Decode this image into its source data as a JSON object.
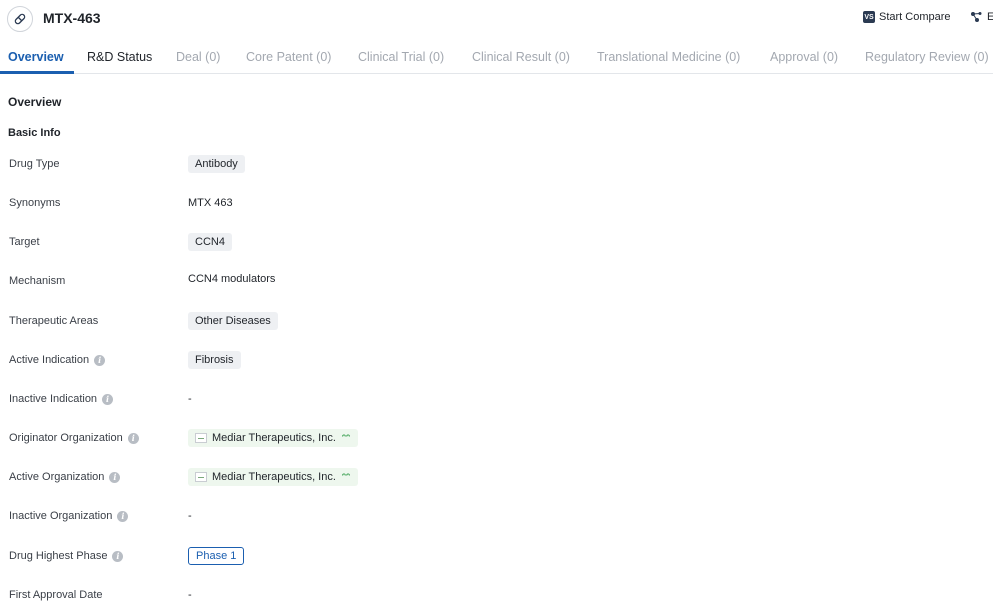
{
  "header": {
    "title": "MTX-463",
    "compare_label": "Start Compare",
    "compare_badge": "VS",
    "more_label": "E"
  },
  "tabs": [
    {
      "label": "Overview"
    },
    {
      "label": "R&D Status"
    },
    {
      "label": "Deal (0)"
    },
    {
      "label": "Core Patent (0)"
    },
    {
      "label": "Clinical Trial (0)"
    },
    {
      "label": "Clinical Result (0)"
    },
    {
      "label": "Translational Medicine (0)"
    },
    {
      "label": "Approval (0)"
    },
    {
      "label": "Regulatory Review (0)"
    }
  ],
  "overview": {
    "title": "Overview",
    "basic_info_title": "Basic Info",
    "fields": {
      "drug_type": {
        "label": "Drug Type",
        "value": "Antibody"
      },
      "synonyms": {
        "label": "Synonyms",
        "value": "MTX 463"
      },
      "target": {
        "label": "Target",
        "value": "CCN4"
      },
      "mechanism": {
        "label": "Mechanism",
        "value": "CCN4 modulators"
      },
      "therapeutic_areas": {
        "label": "Therapeutic Areas",
        "value": "Other Diseases"
      },
      "active_indication": {
        "label": "Active Indication",
        "value": "Fibrosis"
      },
      "inactive_indication": {
        "label": "Inactive Indication",
        "value": "-"
      },
      "originator_org": {
        "label": "Originator Organization",
        "value": "Mediar Therapeutics, Inc."
      },
      "active_org": {
        "label": "Active Organization",
        "value": "Mediar Therapeutics, Inc."
      },
      "inactive_org": {
        "label": "Inactive Organization",
        "value": "-"
      },
      "highest_phase": {
        "label": "Drug Highest Phase",
        "value": "Phase 1"
      },
      "first_approval_date": {
        "label": "First Approval Date",
        "value": "-"
      }
    }
  },
  "colors": {
    "accent": "#1b5fb0",
    "chip_bg": "#eef0f3",
    "org_chip_bg": "#eef7ee"
  }
}
